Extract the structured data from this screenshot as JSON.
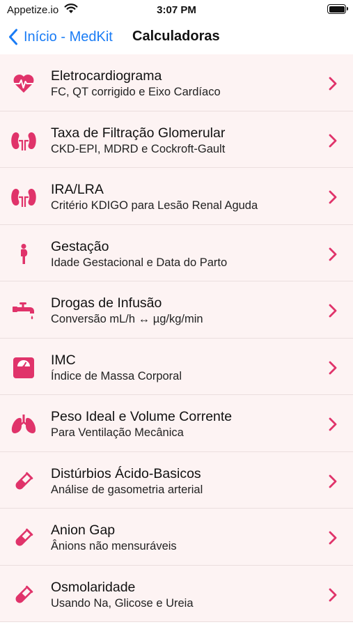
{
  "status_bar": {
    "carrier": "Appetize.io",
    "time": "3:07 PM"
  },
  "nav": {
    "back_label": "Início - MedKit",
    "title": "Calculadoras"
  },
  "colors": {
    "accent": "#e0336a",
    "link": "#1a7cf5",
    "row_background": "#fdf3f3"
  },
  "calculators": [
    {
      "title": "Eletrocardiograma",
      "subtitle": "FC, QT corrigido e Eixo Cardíaco",
      "icon": "heartbeat-icon"
    },
    {
      "title": "Taxa de Filtração Glomerular",
      "subtitle": "CKD-EPI, MDRD e Cockroft-Gault",
      "icon": "kidneys-icon"
    },
    {
      "title": "IRA/LRA",
      "subtitle": "Critério KDIGO para Lesão Renal Aguda",
      "icon": "kidneys-icon"
    },
    {
      "title": "Gestação",
      "subtitle": "Idade Gestacional e Data do Parto",
      "icon": "pregnant-woman-icon"
    },
    {
      "title": "Drogas de Infusão",
      "subtitle": "Conversão mL/h ↔ µg/kg/min",
      "icon": "faucet-icon"
    },
    {
      "title": "IMC",
      "subtitle": "Índice de Massa Corporal",
      "icon": "weight-scale-icon"
    },
    {
      "title": "Peso Ideal e Volume Corrente",
      "subtitle": "Para Ventilação Mecânica",
      "icon": "lungs-icon"
    },
    {
      "title": "Distúrbios Ácido-Basicos",
      "subtitle": "Análise de gasometria arterial",
      "icon": "test-tube-icon"
    },
    {
      "title": "Anion Gap",
      "subtitle": "Ânions não mensuráveis",
      "icon": "test-tube-icon"
    },
    {
      "title": "Osmolaridade",
      "subtitle": "Usando Na, Glicose e Ureia",
      "icon": "test-tube-icon"
    }
  ]
}
